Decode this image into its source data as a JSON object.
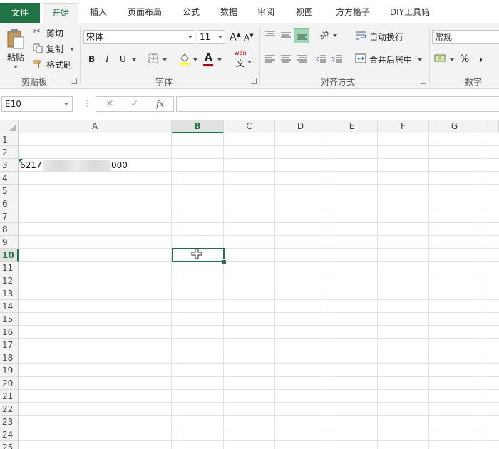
{
  "tabs": {
    "file": "文件",
    "items": [
      "开始",
      "插入",
      "页面布局",
      "公式",
      "数据",
      "审阅",
      "视图",
      "方方格子",
      "DIY工具箱"
    ]
  },
  "ribbon": {
    "clipboard": {
      "paste": "粘贴",
      "cut": "剪切",
      "copy": "复制",
      "format_painter": "格式刷",
      "group_label": "剪贴板"
    },
    "font": {
      "family": "宋体",
      "size": "11",
      "bold": "B",
      "italic": "I",
      "underline": "U",
      "phonetic": "wén",
      "phonetic_char": "文",
      "group_label": "字体",
      "grow": "A",
      "shrink": "A",
      "font_color_letter": "A"
    },
    "alignment": {
      "wrap_text": "自动换行",
      "merge_center": "合并后居中",
      "group_label": "对齐方式"
    },
    "number": {
      "format": "常规",
      "percent": "%",
      "comma": ",",
      "group_label": "数字"
    }
  },
  "formula_bar": {
    "name_box": "E10",
    "fx": "fx",
    "cancel": "✕",
    "confirm": "✓",
    "dots": "⋮",
    "formula": ""
  },
  "sheet": {
    "columns": [
      "A",
      "B",
      "C",
      "D",
      "E",
      "F",
      "G"
    ],
    "rows": [
      "1",
      "2",
      "3",
      "4",
      "5",
      "6",
      "7",
      "8",
      "9",
      "10",
      "11",
      "12",
      "13",
      "14",
      "15",
      "16",
      "17",
      "18",
      "19",
      "20",
      "21",
      "22",
      "23",
      "24",
      "25"
    ],
    "selected_column": "B",
    "selected_row": "10",
    "cells": {
      "A3_prefix": "6217",
      "A3_suffix": "000"
    }
  },
  "colors": {
    "accent": "#217346",
    "ribbon_bg": "#f3f3f3",
    "grid_line": "#e1e1e1"
  }
}
